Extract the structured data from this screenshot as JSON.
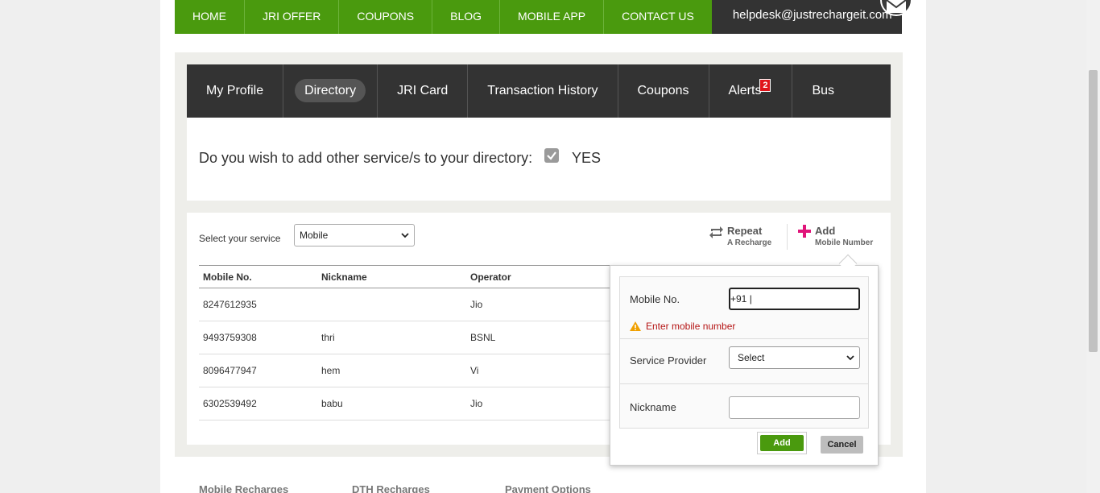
{
  "top_nav": {
    "items": [
      "HOME",
      "JRI OFFER",
      "COUPONS",
      "BLOG",
      "MOBILE APP",
      "CONTACT US"
    ],
    "helpdesk_email": "helpdesk@justrechargeit.com"
  },
  "sub_nav": {
    "items": [
      "My Profile",
      "Directory",
      "JRI Card",
      "Transaction History",
      "Coupons",
      "Alerts",
      "Bus"
    ],
    "active": "Directory",
    "alerts_count": "2"
  },
  "directory_prompt": {
    "question": "Do you wish to add other service/s to your directory:",
    "checked": true,
    "answer": "YES"
  },
  "service": {
    "label": "Select your service",
    "selected": "Mobile"
  },
  "actions": {
    "repeat_title": "Repeat",
    "repeat_sub": "A Recharge",
    "add_title": "Add",
    "add_sub": "Mobile Number"
  },
  "table": {
    "headers": [
      "Mobile No.",
      "Nickname",
      "Operator"
    ],
    "rows": [
      {
        "mobile": "8247612935",
        "nickname": "",
        "operator": "Jio"
      },
      {
        "mobile": "9493759308",
        "nickname": "thri",
        "operator": "BSNL"
      },
      {
        "mobile": "8096477947",
        "nickname": "hem",
        "operator": "Vi"
      },
      {
        "mobile": "6302539492",
        "nickname": "babu",
        "operator": "Jio"
      }
    ]
  },
  "add_form": {
    "mobile_label": "Mobile No.",
    "mobile_value": "+91 |",
    "error": "Enter mobile number",
    "provider_label": "Service Provider",
    "provider_selected": "Select",
    "nickname_label": "Nickname",
    "nickname_value": "",
    "add_button": "Add",
    "cancel_button": "Cancel"
  },
  "footer": {
    "links": [
      "Mobile Recharges",
      "DTH Recharges",
      "Payment Options"
    ]
  },
  "colors": {
    "green": "#4a9a0e",
    "dark": "#333333",
    "alert_red": "#e0151b",
    "error_red": "#b51515",
    "add_pink": "#e0157a"
  }
}
